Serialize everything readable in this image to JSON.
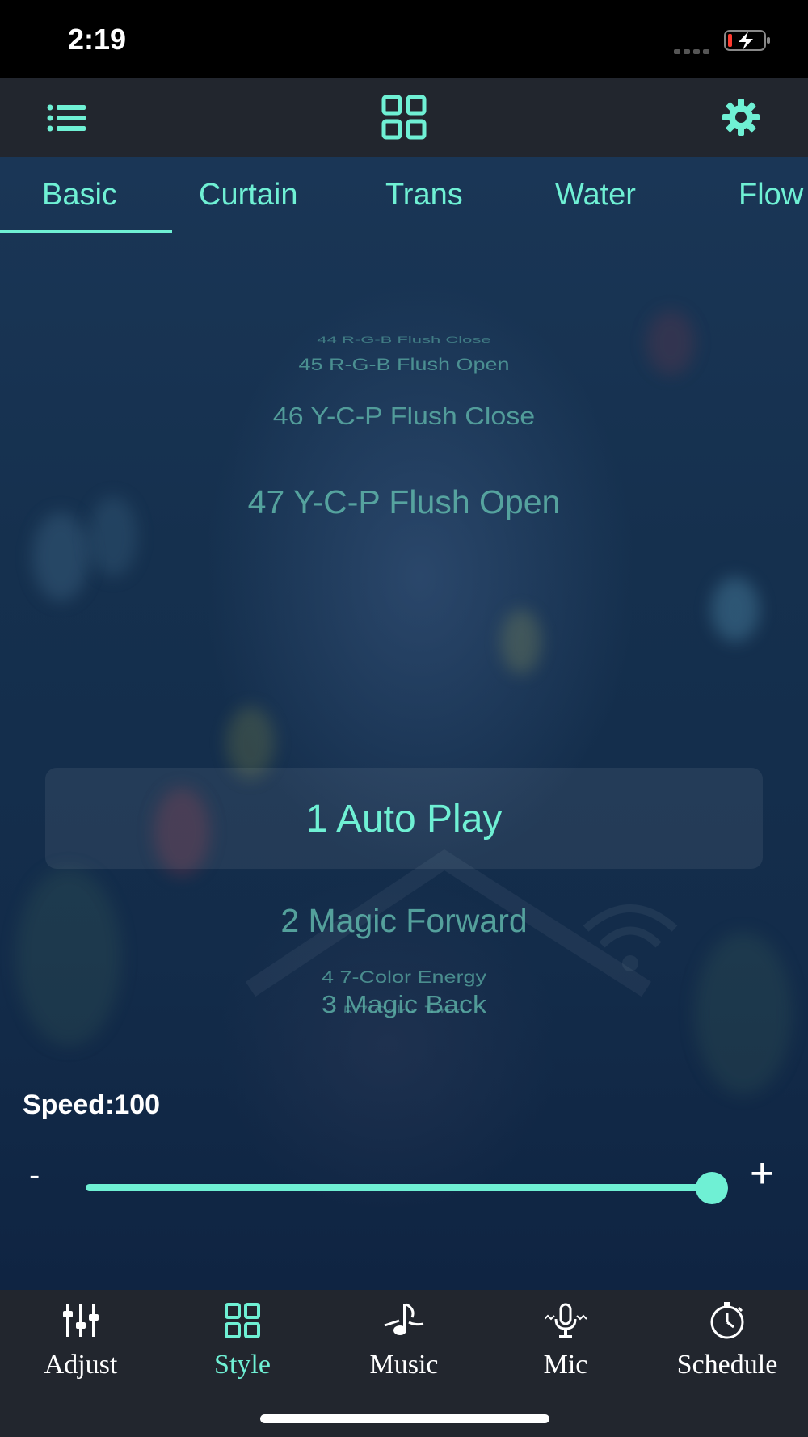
{
  "status": {
    "time": "2:19"
  },
  "tabs": [
    {
      "label": "Basic",
      "active": true
    },
    {
      "label": "Curtain"
    },
    {
      "label": "Trans"
    },
    {
      "label": "Water"
    },
    {
      "label": "Flow"
    }
  ],
  "picker": {
    "items": [
      "44 R-G-B Flush Close",
      "45 R-G-B Flush Open",
      "46 Y-C-P Flush Close",
      "47 Y-C-P Flush Open",
      "1 Auto Play",
      "2 Magic Forward",
      "3 Magic Back",
      "4 7-Color Energy",
      "5 7-Color Jump"
    ],
    "selected": "1 Auto Play"
  },
  "speed": {
    "label": "Speed:100",
    "value": 100,
    "max": 100,
    "minus": "-",
    "plus": "+"
  },
  "nav": [
    {
      "label": "Adjust",
      "icon": "sliders-icon"
    },
    {
      "label": "Style",
      "icon": "grid-icon",
      "active": true
    },
    {
      "label": "Music",
      "icon": "music-note-icon"
    },
    {
      "label": "Mic",
      "icon": "microphone-icon"
    },
    {
      "label": "Schedule",
      "icon": "stopwatch-icon"
    }
  ],
  "colors": {
    "accent": "#6ff0d4",
    "bar": "#22262e",
    "text": "#ffffff"
  }
}
